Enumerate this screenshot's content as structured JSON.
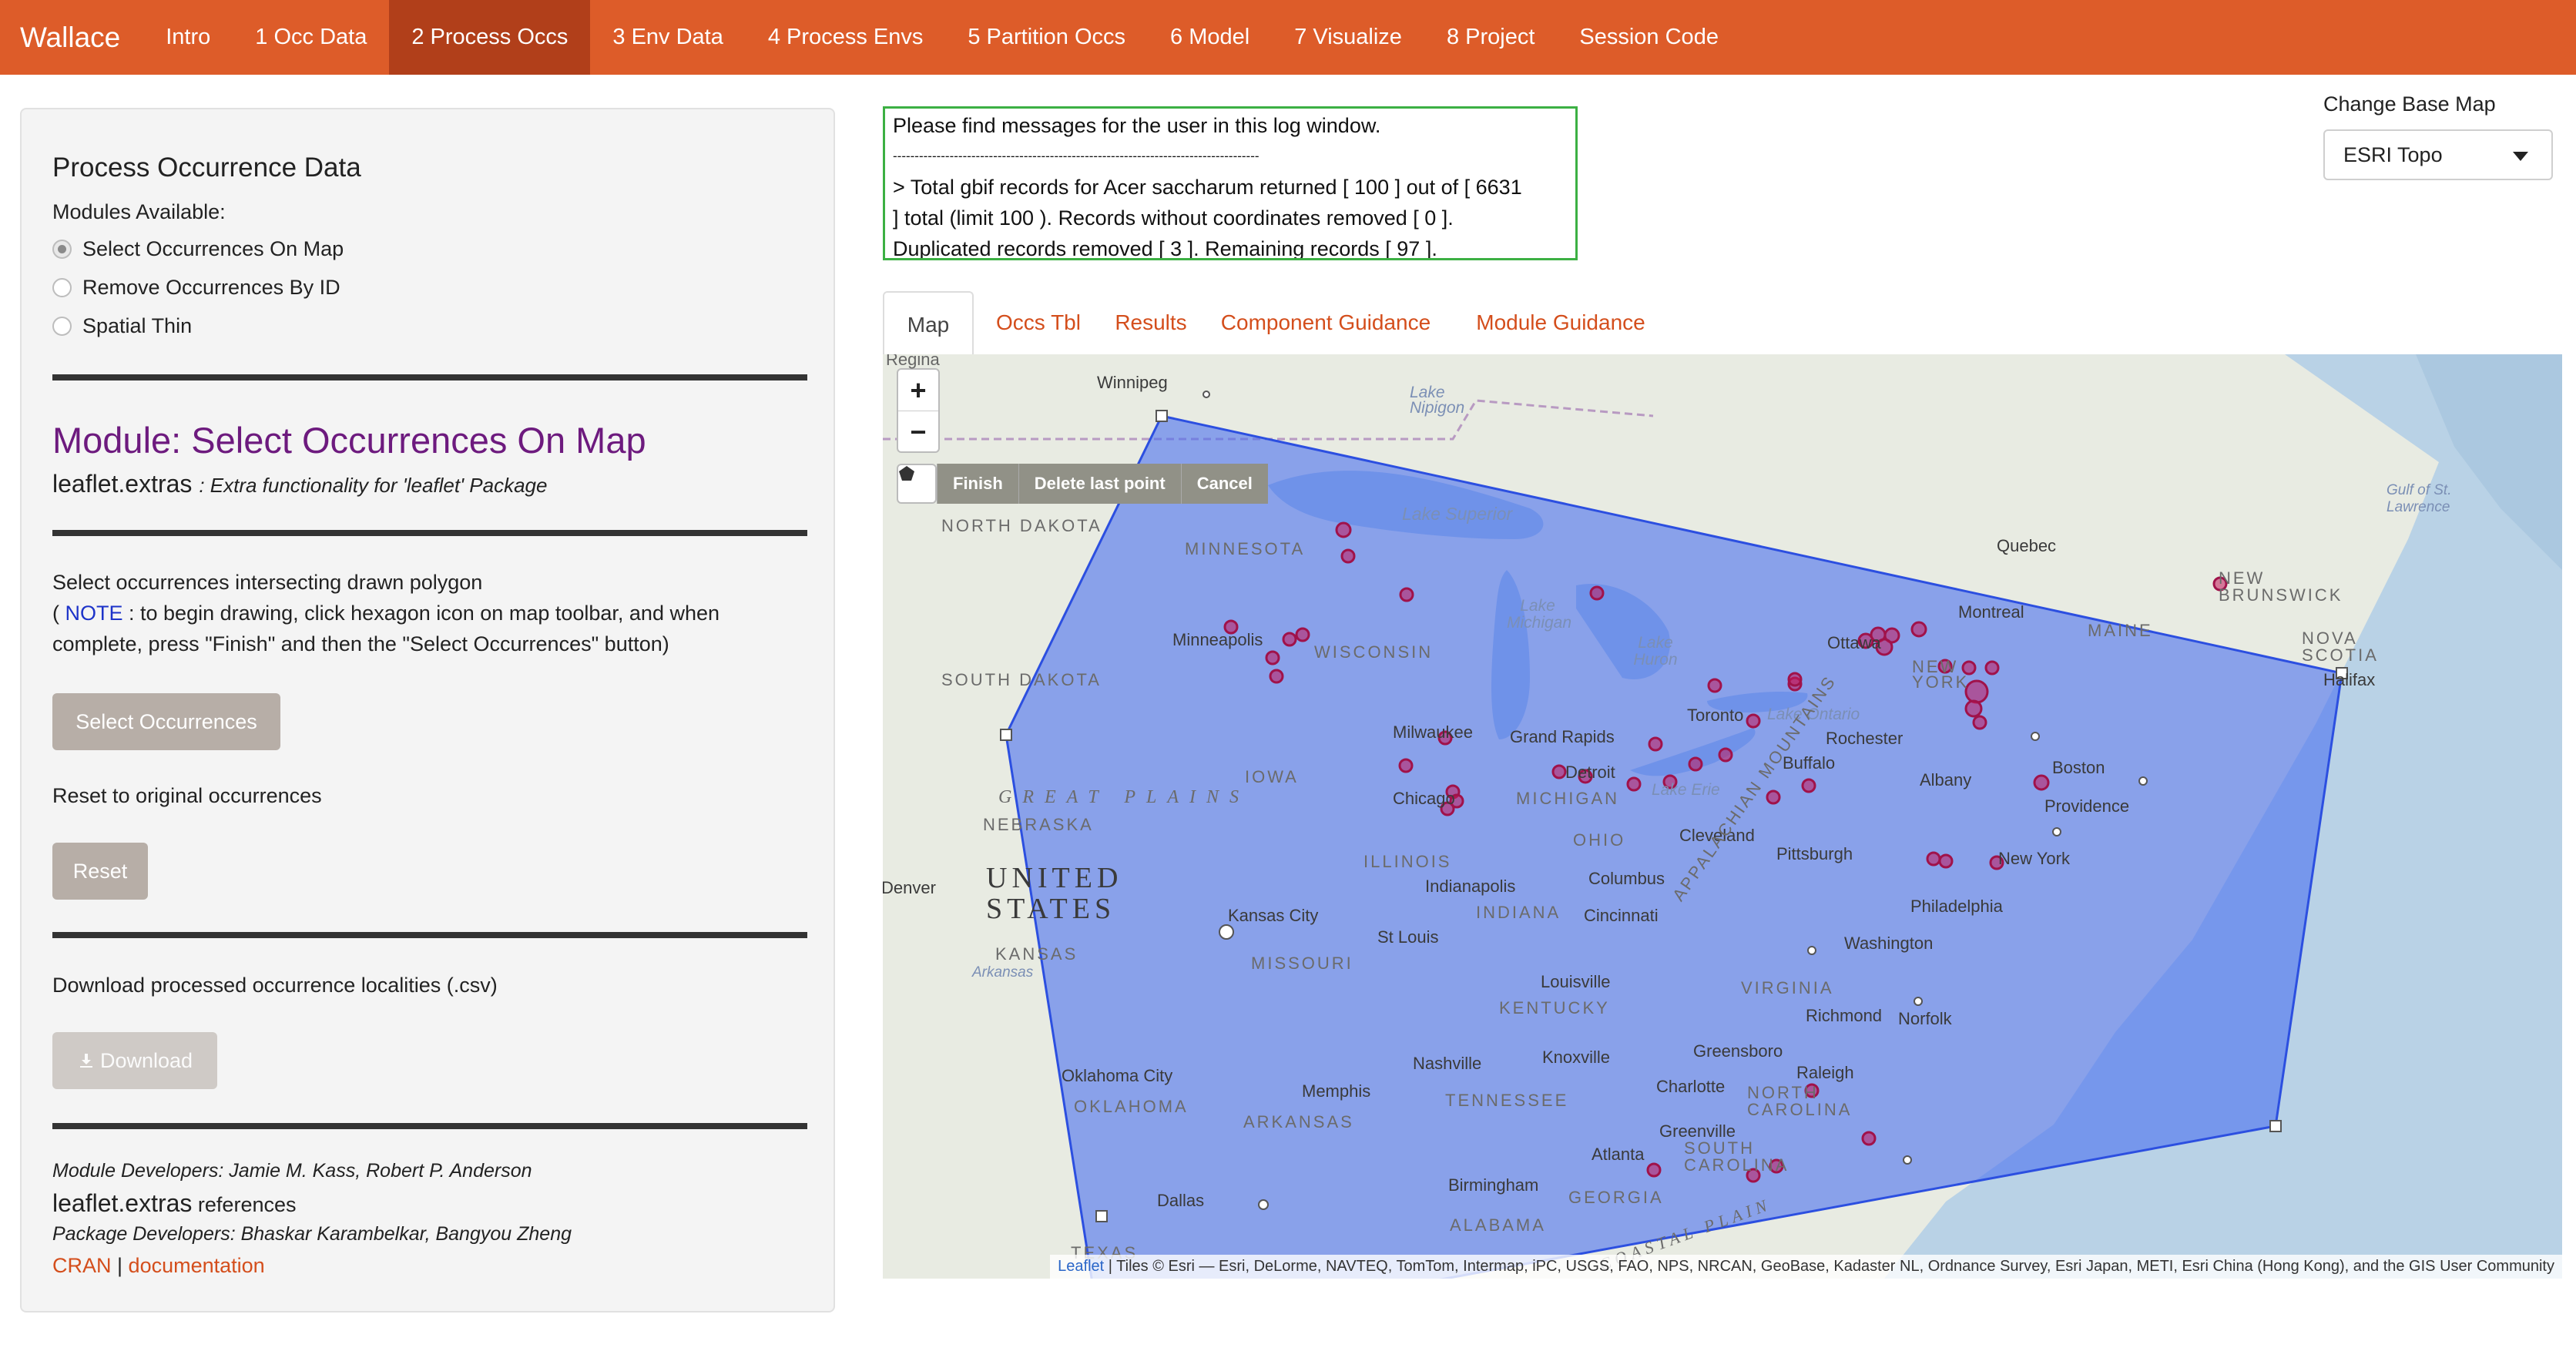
{
  "navbar": {
    "brand": "Wallace",
    "items": [
      "Intro",
      "1 Occ Data",
      "2 Process Occs",
      "3 Env Data",
      "4 Process Envs",
      "5 Partition Occs",
      "6 Model",
      "7 Visualize",
      "8 Project",
      "Session Code"
    ],
    "active": "2 Process Occs"
  },
  "sidebar": {
    "title": "Process Occurrence Data",
    "modules_label": "Modules Available:",
    "modules": [
      {
        "label": "Select Occurrences On Map",
        "selected": true
      },
      {
        "label": "Remove Occurrences By ID",
        "selected": false
      },
      {
        "label": "Spatial Thin",
        "selected": false
      }
    ],
    "module_title": "Module: Select Occurrences On Map",
    "package_name": "leaflet.extras",
    "package_desc": ": Extra functionality for 'leaflet' Package",
    "instruction_heading": "Select occurrences intersecting drawn polygon",
    "note_open": "( ",
    "note_word": "NOTE",
    "note_text": " : to begin drawing, click hexagon icon on map toolbar, and when",
    "note_text2": "complete, press \"Finish\" and then the \"Select Occurrences\" button)",
    "select_button": "Select Occurrences",
    "reset_label": "Reset to original occurrences",
    "reset_button": "Reset",
    "download_label": "Download processed occurrence localities (.csv)",
    "download_button": "Download",
    "module_developers": "Module Developers: Jamie M. Kass, Robert P. Anderson",
    "references_pkg": "leaflet.extras",
    "references_word": " references",
    "package_developers": "Package Developers: Bhaskar Karambelkar, Bangyou Zheng",
    "cran": "CRAN",
    "separator": " | ",
    "documentation": "documentation"
  },
  "log": {
    "lines": [
      "Please find messages for the user in this log window.",
      "------------------------------------------------------------------------------------",
      "> Total gbif records for Acer saccharum returned [ 100 ] out of [ 6631",
      "] total (limit 100 ). Records without coordinates removed [ 0 ].",
      "Duplicated records removed [ 3 ]. Remaining records [ 97 ]."
    ]
  },
  "basemap": {
    "label": "Change Base Map",
    "value": "ESRI Topo"
  },
  "tabs": [
    "Map",
    "Occs Tbl",
    "Results",
    "Component Guidance",
    "Module Guidance"
  ],
  "active_tab": "Map",
  "map": {
    "zoom_in": "+",
    "zoom_out": "−",
    "draw_actions": [
      "Finish",
      "Delete last point",
      "Cancel"
    ],
    "attribution_leaflet": "Leaflet",
    "attribution_rest": " | Tiles © Esri — Esri, DeLorme, NAVTEQ, TomTom, Intermap, iPC, USGS, FAO, NPS, NRCAN, GeoBase, Kadaster NL, Ordnance Survey, Esri Japan, METI, Esri China (Hong Kong), and the GIS User Community",
    "labels": {
      "regina": "Regina",
      "winnipeg": "Winnipeg",
      "lake_nipigon": "Lake Nipigon",
      "north_dakota": "NORTH DAKOTA",
      "minnesota": "MINNESOTA",
      "lake_superior": "Lake Superior",
      "gulf_st_lawrence": "Gulf of St. Lawrence",
      "quebec": "Quebec",
      "new_brunswick": "NEW BRUNSWICK",
      "montreal": "Montreal",
      "maine": "MAINE",
      "nova_scotia": "NOVA SCOTIA",
      "halifax": "Halifax",
      "south_dakota": "SOUTH DAKOTA",
      "minneapolis": "Minneapolis",
      "wisconsin": "WISCONSIN",
      "lake_michigan": "Lake Michigan",
      "lake_huron": "Lake Huron",
      "ottawa": "Ottawa",
      "new_york_state": "NEW YORK",
      "toronto": "Toronto",
      "lake_ontario": "Lake Ontario",
      "rochester": "Rochester",
      "milwaukee": "Milwaukee",
      "grand_rapids": "Grand Rapids",
      "buffalo": "Buffalo",
      "albany": "Albany",
      "boston": "Boston",
      "iowa": "IOWA",
      "detroit": "Detroit",
      "providence": "Providence",
      "great_plains": "GREAT PLAINS",
      "chicago": "Chicago",
      "michigan": "MICHIGAN",
      "lake_erie": "Lake Erie",
      "nebraska": "NEBRASKA",
      "ohio": "OHIO",
      "cleveland": "Cleveland",
      "pittsburgh": "Pittsburgh",
      "new_york_city": "New York",
      "illinois": "ILLINOIS",
      "united_states": "UNITED STATES",
      "denver": "Denver",
      "indianapolis": "Indianapolis",
      "columbus": "Columbus",
      "appalachian": "APPALACHIAN MOUNTAINS",
      "philadelphia": "Philadelphia",
      "indiana": "INDIANA",
      "kansas_city": "Kansas City",
      "cincinnati": "Cincinnati",
      "st_louis": "St Louis",
      "washington": "Washington",
      "kansas": "KANSAS",
      "missouri": "MISSOURI",
      "arkansas_river": "Arkansas",
      "louisville": "Louisville",
      "virginia": "VIRGINIA",
      "kentucky": "KENTUCKY",
      "richmond": "Richmond",
      "norfolk": "Norfolk",
      "nashville": "Nashville",
      "knoxville": "Knoxville",
      "greensboro": "Greensboro",
      "oklahoma_city": "Oklahoma City",
      "memphis": "Memphis",
      "raleigh": "Raleigh",
      "charlotte": "Charlotte",
      "north_carolina": "NORTH CAROLINA",
      "oklahoma": "OKLAHOMA",
      "tennessee": "TENNESSEE",
      "arkansas": "ARKANSAS",
      "greenville": "Greenville",
      "south_carolina": "SOUTH CAROLINA",
      "atlanta": "Atlanta",
      "birmingham": "Birmingham",
      "georgia": "GEORGIA",
      "dallas": "Dallas",
      "alabama": "ALABAMA",
      "texas": "TEXAS",
      "coastal_plain": "COASTAL PLAIN"
    }
  },
  "colors": {
    "navbar": "#dd5c29",
    "navbar_active": "#b13f1a",
    "module_title": "#6d1a7e",
    "link": "#d44e1c",
    "log_border": "#3cb043",
    "polygon_fill": "#4a6ff0",
    "occurrence": "#c2185b"
  }
}
